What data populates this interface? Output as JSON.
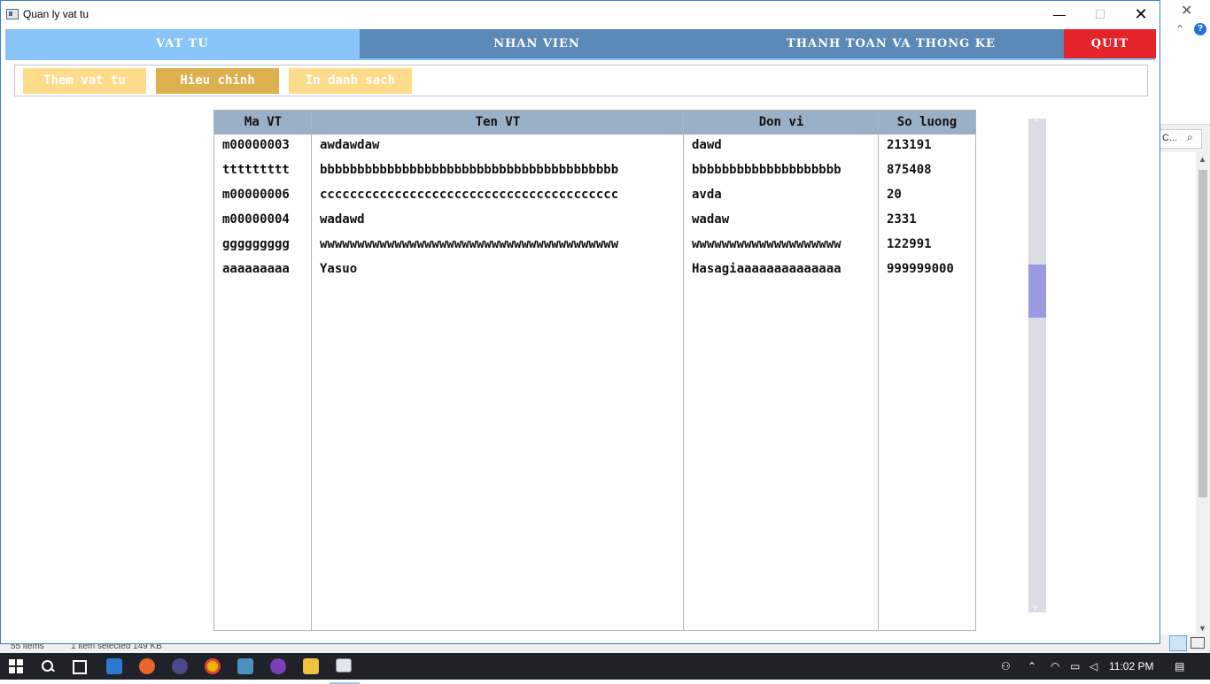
{
  "window": {
    "title": "Quan ly vat tu",
    "minimize": "—",
    "maximize": "☐",
    "close": "✕"
  },
  "nav": {
    "tabs": [
      "VAT TU",
      "NHAN VIEN",
      "THANH TOAN VA THONG KE"
    ],
    "quit": "QUIT"
  },
  "toolbar": {
    "add_label": "Them vat tu",
    "edit_label": "Hieu chinh",
    "print_label": "In danh sach"
  },
  "table": {
    "columns": [
      "Ma VT",
      "Ten VT",
      "Don vi",
      "So luong"
    ],
    "rows": [
      [
        "m00000003",
        "awdawdaw",
        "dawd",
        "213191"
      ],
      [
        "ttttttttt",
        "bbbbbbbbbbbbbbbbbbbbbbbbbbbbbbbbbbbbbbbb",
        "bbbbbbbbbbbbbbbbbbbb",
        "875408"
      ],
      [
        "m00000006",
        "cccccccccccccccccccccccccccccccccccccccc",
        "avda",
        "20"
      ],
      [
        "m00000004",
        "wadawd",
        "wadaw",
        "2331"
      ],
      [
        "ggggggggg",
        "wwwwwwwwwwwwwwwwwwwwwwwwwwwwwwwwwwwwwwww",
        "wwwwwwwwwwwwwwwwwwww",
        "122991"
      ],
      [
        "aaaaaaaaa",
        "Yasuo",
        "Hasagiaaaaaaaaaaaaaa",
        "999999000"
      ]
    ]
  },
  "scrollbar": {
    "up": "^",
    "down": "v"
  },
  "background_window": {
    "close": "✕",
    "chevron": "⌃",
    "help": "?",
    "search_placeholder": "C...",
    "status_left": "55 items",
    "status_mid": "1 item selected  149 KB"
  },
  "taskbar": {
    "time": "11:02 PM"
  },
  "colors": {
    "nav_bg": "#5b8ab8",
    "nav_active": "#88c4f8",
    "quit_bg": "#e4232b",
    "button_light": "#ffdc8c",
    "button_active": "#ddb050",
    "table_header": "#9ab0c6"
  }
}
